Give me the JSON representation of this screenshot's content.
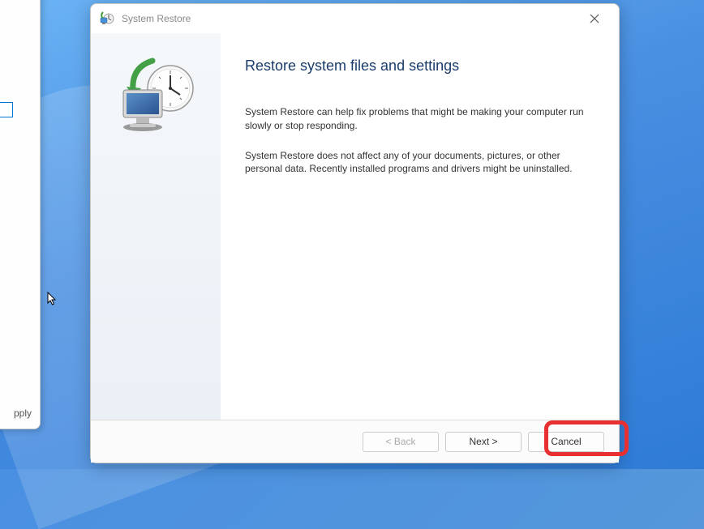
{
  "window": {
    "title": "System Restore"
  },
  "content": {
    "heading": "Restore system files and settings",
    "paragraph1": "System Restore can help fix problems that might be making your computer run slowly or stop responding.",
    "paragraph2": "System Restore does not affect any of your documents, pictures, or other personal data. Recently installed programs and drivers might be uninstalled."
  },
  "buttons": {
    "back": "< Back",
    "next": "Next >",
    "cancel": "Cancel"
  },
  "background": {
    "apply": "pply"
  }
}
